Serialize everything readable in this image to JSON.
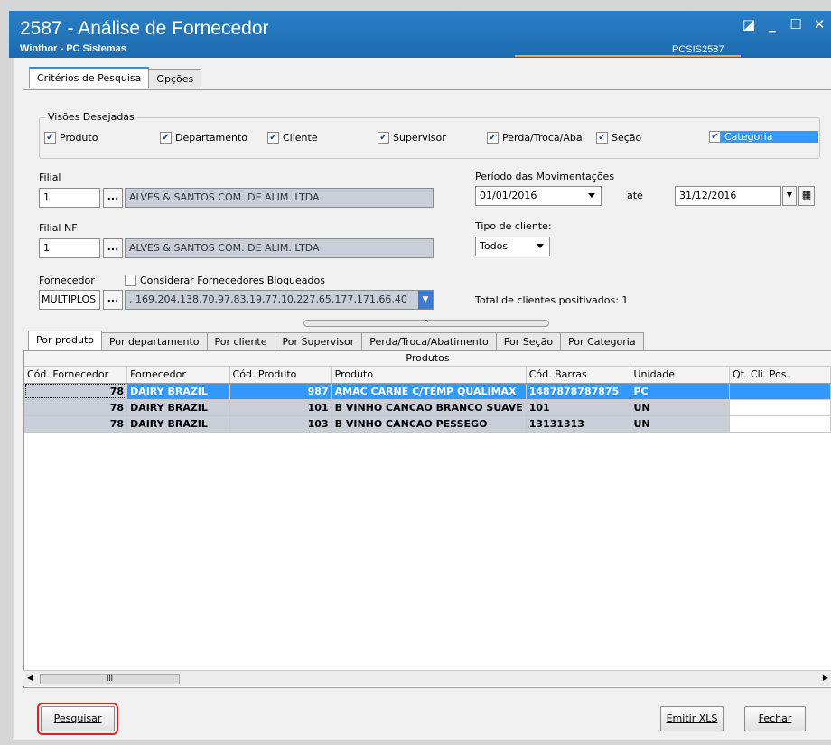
{
  "window": {
    "title": "2587 - Análise de Fornecedor",
    "subtitle": "Winthor - PC Sistemas",
    "code": "PCSIS2587",
    "controls": [
      "◪",
      "_",
      "☐",
      "✕"
    ]
  },
  "tabs_top": [
    {
      "label": "Critérios de Pesquisa",
      "active": true
    },
    {
      "label": "Opções",
      "active": false
    }
  ],
  "visoes": {
    "legend": "Visões Desejadas",
    "items": [
      {
        "label": "Produto",
        "checked": true
      },
      {
        "label": "Departamento",
        "checked": true
      },
      {
        "label": "Cliente",
        "checked": true
      },
      {
        "label": "Supervisor",
        "checked": true
      },
      {
        "label": "Perda/Troca/Aba.",
        "checked": true
      },
      {
        "label": "Seção",
        "checked": true
      },
      {
        "label": "Categoria",
        "checked": true,
        "selected": true
      }
    ]
  },
  "filial": {
    "label": "Filial",
    "code": "1",
    "name": "ALVES & SANTOS COM. DE ALIM. LTDA"
  },
  "filial_nf": {
    "label": "Filial NF",
    "code": "1",
    "name": "ALVES & SANTOS COM. DE ALIM. LTDA"
  },
  "fornecedor": {
    "label": "Fornecedor",
    "bloqueados_label": "Considerar Fornecedores Bloqueados",
    "bloqueados_checked": false,
    "code": "MULTIPLOS",
    "list": ", 169,204,138,70,97,83,19,77,10,227,65,177,171,66,40"
  },
  "periodo": {
    "label": "Período das Movimentações",
    "from": "01/01/2016",
    "ate_label": "até",
    "to": "31/12/2016"
  },
  "tipo_cliente": {
    "label": "Tipo de cliente:",
    "value": "Todos"
  },
  "total_clientes": "Total de clientes positivados: 1",
  "dots_label": "...",
  "tabs_bottom": [
    {
      "label": "Por produto",
      "active": true
    },
    {
      "label": "Por departamento",
      "active": false
    },
    {
      "label": "Por cliente",
      "active": false
    },
    {
      "label": "Por Supervisor",
      "active": false
    },
    {
      "label": "Perda/Troca/Abatimento",
      "active": false
    },
    {
      "label": "Por Seção",
      "active": false
    },
    {
      "label": "Por Categoria",
      "active": false
    }
  ],
  "grid": {
    "band": "Produtos",
    "columns": [
      "Cód. Fornecedor",
      "Fornecedor",
      "Cód. Produto",
      "Produto",
      "Cód. Barras",
      "Unidade",
      "Qt. Cli. Pos."
    ],
    "rows": [
      [
        "78",
        "DAIRY BRAZIL",
        "987",
        "AMAC CARNE C/TEMP QUALIMAX",
        "1487878787875",
        "PC",
        ""
      ],
      [
        "78",
        "DAIRY BRAZIL",
        "101",
        "B VINHO CANCAO BRANCO SUAVE",
        "101",
        "UN",
        ""
      ],
      [
        "78",
        "DAIRY BRAZIL",
        "103",
        "B VINHO CANCAO PESSEGO",
        "13131313",
        "UN",
        ""
      ]
    ]
  },
  "scroll_thumb": "III",
  "buttons": {
    "pesquisar": "Pesquisar",
    "emitir": "Emitir XLS",
    "fechar": "Fechar"
  }
}
